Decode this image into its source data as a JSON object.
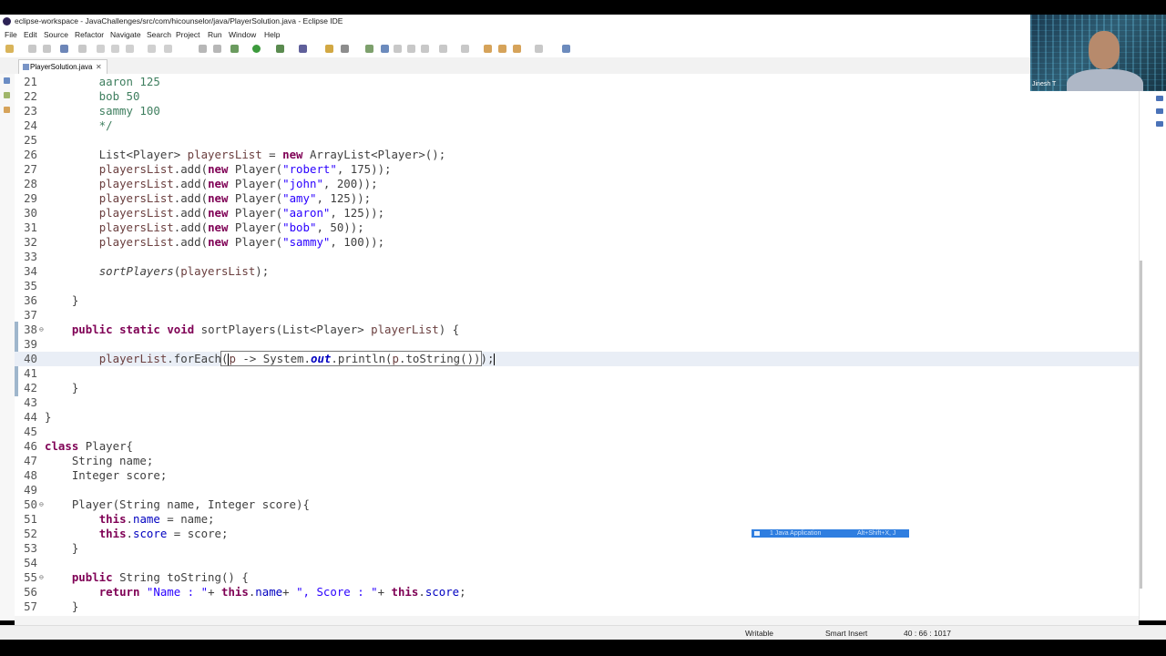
{
  "window": {
    "title": "eclipse-workspace - JavaChallenges/src/com/hicounselor/java/PlayerSolution.java - Eclipse IDE"
  },
  "menu": [
    {
      "label": "File"
    },
    {
      "label": "Edit"
    },
    {
      "label": "Source"
    },
    {
      "label": "Refactor"
    },
    {
      "label": "Navigate"
    },
    {
      "label": "Search"
    },
    {
      "label": "Project"
    },
    {
      "label": "Run"
    },
    {
      "label": "Window"
    },
    {
      "label": "Help"
    }
  ],
  "editor_tab": {
    "label": "PlayerSolution.java",
    "close": "✕"
  },
  "code": {
    "lines": [
      {
        "n": "21",
        "t": "        aaron 125"
      },
      {
        "n": "22",
        "t": "        bob 50"
      },
      {
        "n": "23",
        "t": "        sammy 100"
      },
      {
        "n": "24",
        "t": "        */"
      },
      {
        "n": "25",
        "t": ""
      },
      {
        "n": "26",
        "t": "        List<Player> playersList = new ArrayList<Player>();"
      },
      {
        "n": "27",
        "t": "        playersList.add(new Player(\"robert\", 175));"
      },
      {
        "n": "28",
        "t": "        playersList.add(new Player(\"john\", 200));"
      },
      {
        "n": "29",
        "t": "        playersList.add(new Player(\"amy\", 125));"
      },
      {
        "n": "30",
        "t": "        playersList.add(new Player(\"aaron\", 125));"
      },
      {
        "n": "31",
        "t": "        playersList.add(new Player(\"bob\", 50));"
      },
      {
        "n": "32",
        "t": "        playersList.add(new Player(\"sammy\", 100));"
      },
      {
        "n": "33",
        "t": ""
      },
      {
        "n": "34",
        "t": "        sortPlayers(playersList);"
      },
      {
        "n": "35",
        "t": ""
      },
      {
        "n": "36",
        "t": "    }"
      },
      {
        "n": "37",
        "t": ""
      },
      {
        "n": "38",
        "t": "    public static void sortPlayers(List<Player> playerList) {"
      },
      {
        "n": "39",
        "t": ""
      },
      {
        "n": "40",
        "t": "        playerList.forEach(p -> System.out.println(p.toString()));"
      },
      {
        "n": "41",
        "t": ""
      },
      {
        "n": "42",
        "t": "    }"
      },
      {
        "n": "43",
        "t": ""
      },
      {
        "n": "44",
        "t": "}"
      },
      {
        "n": "45",
        "t": ""
      },
      {
        "n": "46",
        "t": "class Player{"
      },
      {
        "n": "47",
        "t": "    String name;"
      },
      {
        "n": "48",
        "t": "    Integer score;"
      },
      {
        "n": "49",
        "t": ""
      },
      {
        "n": "50",
        "t": "    Player(String name, Integer score){"
      },
      {
        "n": "51",
        "t": "        this.name = name;"
      },
      {
        "n": "52",
        "t": "        this.score = score;"
      },
      {
        "n": "53",
        "t": "    }"
      },
      {
        "n": "54",
        "t": ""
      },
      {
        "n": "55",
        "t": "    public String toString() {"
      },
      {
        "n": "56",
        "t": "        return \"Name : \"+ this.name+ \", Score : \"+ this.score;"
      },
      {
        "n": "57",
        "t": "    }"
      }
    ]
  },
  "popup": {
    "label": "1 Java Application",
    "shortcut": "Alt+Shift+X, J"
  },
  "status": {
    "writable": "Writable",
    "insert_mode": "Smart Insert",
    "position": "40 : 66 : 1017"
  },
  "webcam": {
    "name": "Jinesh T"
  }
}
